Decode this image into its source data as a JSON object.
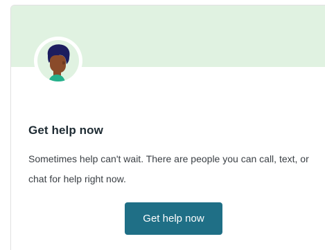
{
  "card": {
    "avatar_icon": "person-avatar-icon",
    "title": "Get help now",
    "description": "Sometimes help can't wait. There are people you can call, text, or chat for help right now.",
    "button_label": "Get help now"
  },
  "colors": {
    "banner": "#e0f2e1",
    "button": "#1f6f86",
    "title": "#1e2b33",
    "body_text": "#3a3f44"
  }
}
